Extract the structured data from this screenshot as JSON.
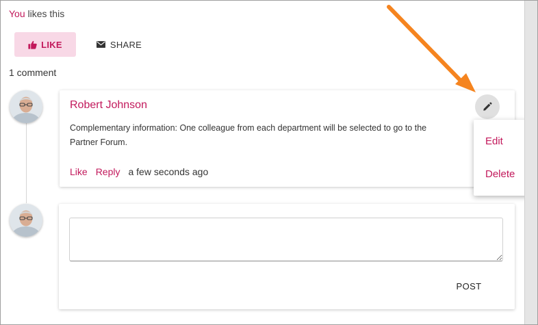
{
  "likes": {
    "you": "You",
    "suffix": " likes this"
  },
  "buttons": {
    "like_label": "LIKE",
    "share_label": "SHARE"
  },
  "comments": {
    "count_label": "1 comment"
  },
  "comment": {
    "author": "Robert Johnson",
    "text": "Complementary information: One colleague from each department will be selected to go to the Partner Forum.",
    "actions": {
      "like": "Like",
      "reply": "Reply"
    },
    "timestamp": "a few seconds ago"
  },
  "menu": {
    "items": [
      {
        "label": "Edit"
      },
      {
        "label": "Delete"
      }
    ]
  },
  "reply": {
    "post_label": "POST"
  },
  "colors": {
    "accent": "#c2185b",
    "like_bg": "#f8d8e6",
    "annotation_arrow": "#f5841f"
  },
  "icons": {
    "like": "thumbs-up-icon",
    "share": "envelope-icon",
    "edit": "pencil-icon"
  }
}
